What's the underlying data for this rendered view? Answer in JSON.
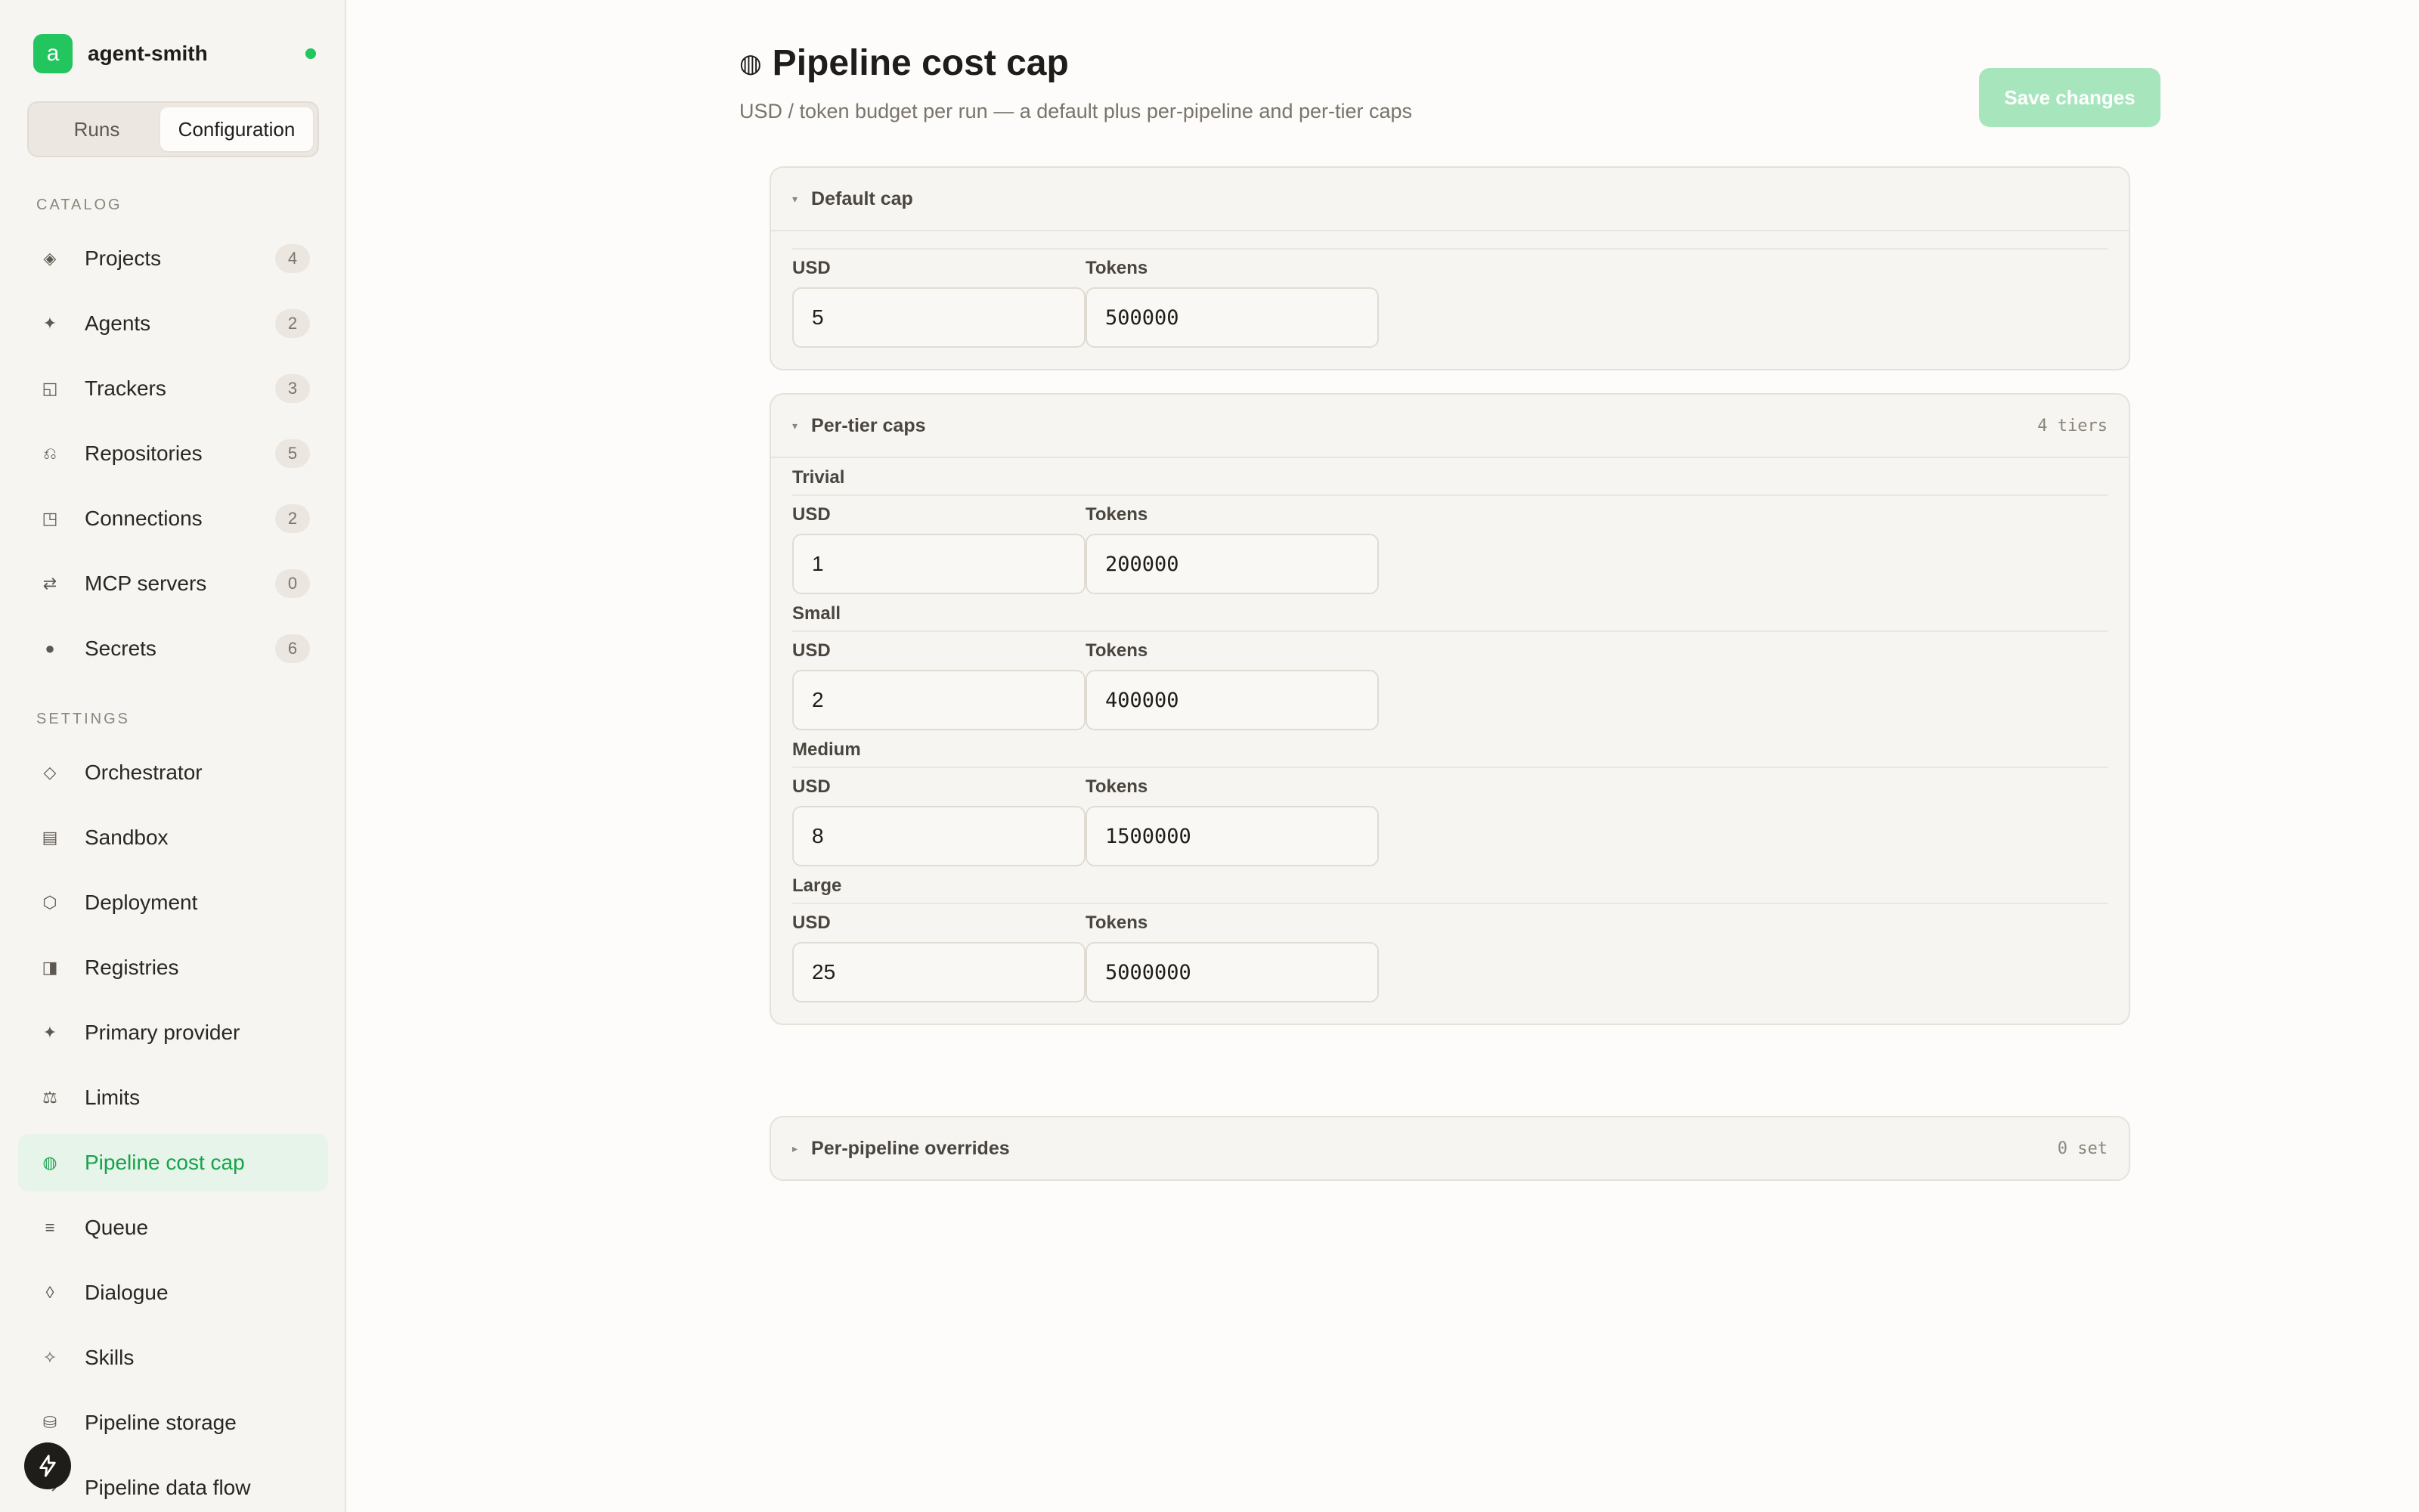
{
  "workspace": {
    "avatar_letter": "a",
    "name": "agent-smith"
  },
  "segmented": {
    "runs": "Runs",
    "configuration": "Configuration"
  },
  "catalog": {
    "label": "CATALOG",
    "items": [
      {
        "label": "Projects",
        "count": "4",
        "icon": "diamond-icon"
      },
      {
        "label": "Agents",
        "count": "2",
        "icon": "sparkle-icon"
      },
      {
        "label": "Trackers",
        "count": "3",
        "icon": "tracker-icon"
      },
      {
        "label": "Repositories",
        "count": "5",
        "icon": "branch-icon"
      },
      {
        "label": "Connections",
        "count": "2",
        "icon": "plug-icon"
      },
      {
        "label": "MCP servers",
        "count": "0",
        "icon": "arrows-icon"
      },
      {
        "label": "Secrets",
        "count": "6",
        "icon": "key-icon"
      }
    ]
  },
  "settings": {
    "label": "SETTINGS",
    "items": [
      {
        "label": "Orchestrator",
        "icon": "diamond-outline-icon"
      },
      {
        "label": "Sandbox",
        "icon": "box-icon"
      },
      {
        "label": "Deployment",
        "icon": "hexagon-icon"
      },
      {
        "label": "Registries",
        "icon": "registry-icon"
      },
      {
        "label": "Primary provider",
        "icon": "sparkle-icon"
      },
      {
        "label": "Limits",
        "icon": "scale-icon"
      },
      {
        "label": "Pipeline cost cap",
        "icon": "coin-icon"
      },
      {
        "label": "Queue",
        "icon": "list-icon"
      },
      {
        "label": "Dialogue",
        "icon": "drop-icon"
      },
      {
        "label": "Skills",
        "icon": "star-outline-icon"
      },
      {
        "label": "Pipeline storage",
        "icon": "database-icon"
      },
      {
        "label": "Pipeline data flow",
        "icon": "flow-icon"
      }
    ]
  },
  "page": {
    "title": "Pipeline cost cap",
    "subtitle": "USD / token budget per run — a default plus per-pipeline and per-tier caps",
    "save_label": "Save changes"
  },
  "default_cap": {
    "title": "Default cap",
    "usd_label": "USD",
    "tokens_label": "Tokens",
    "usd": "5",
    "tokens": "500000"
  },
  "tier_caps": {
    "title": "Per-tier caps",
    "meta": "4 tiers",
    "usd_label": "USD",
    "tokens_label": "Tokens",
    "tiers": [
      {
        "name": "Trivial",
        "usd": "1",
        "tokens": "200000"
      },
      {
        "name": "Small",
        "usd": "2",
        "tokens": "400000"
      },
      {
        "name": "Medium",
        "usd": "8",
        "tokens": "1500000"
      },
      {
        "name": "Large",
        "usd": "25",
        "tokens": "5000000"
      }
    ]
  },
  "overrides": {
    "title": "Per-pipeline overrides",
    "meta": "0 set"
  },
  "colors": {
    "accent": "#22c55e",
    "active_bg": "#e6f4ea",
    "save_disabled": "#a7e6bd"
  }
}
